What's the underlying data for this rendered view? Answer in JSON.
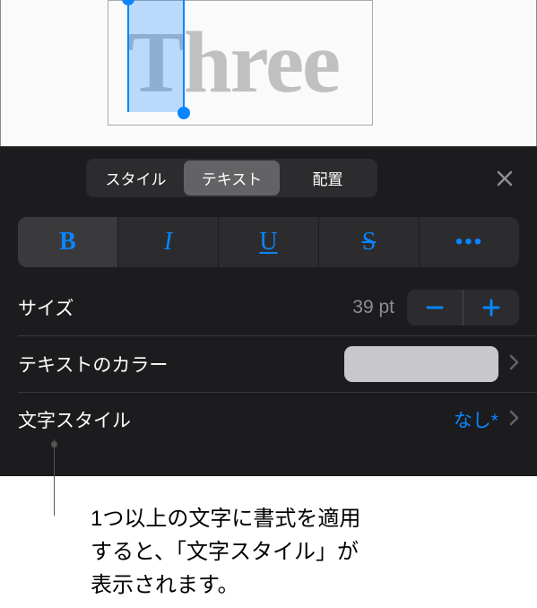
{
  "canvas": {
    "sample_text": "Three"
  },
  "tabs": {
    "style": "スタイル",
    "text": "テキスト",
    "arrange": "配置"
  },
  "format": {
    "bold": "B",
    "italic": "I",
    "underline": "U",
    "strike": "S",
    "more": "•••"
  },
  "size": {
    "label": "サイズ",
    "value": "39 pt"
  },
  "text_color": {
    "label": "テキストのカラー",
    "color": "#c7c7cc"
  },
  "char_style": {
    "label": "文字スタイル",
    "value": "なし*"
  },
  "callout": {
    "line1": "1つ以上の文字に書式を適用",
    "line2": "すると、「文字スタイル」が",
    "line3": "表示されます。"
  }
}
